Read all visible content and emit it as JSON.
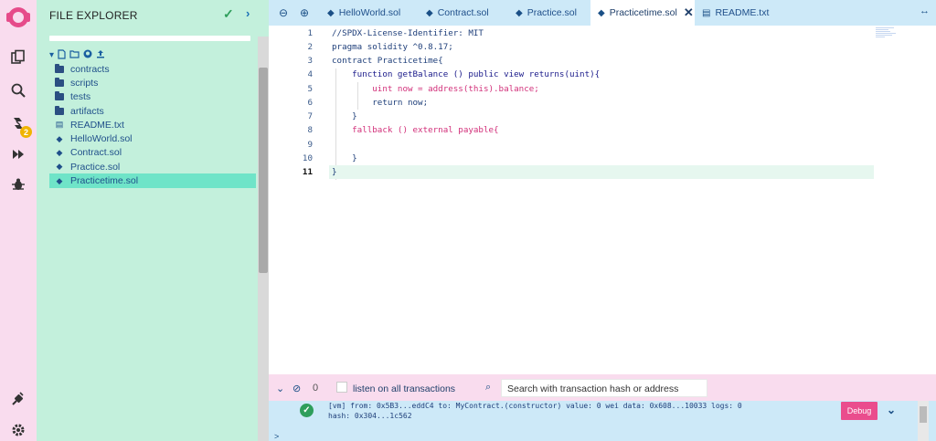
{
  "icon_panel": {
    "items": [
      {
        "name": "file-explorer-icon"
      },
      {
        "name": "search-icon"
      },
      {
        "name": "solidity-compiler-icon",
        "badge": "2"
      },
      {
        "name": "deploy-run-icon"
      },
      {
        "name": "debugger-icon"
      },
      {
        "name": "plugin-manager-icon"
      },
      {
        "name": "settings-icon"
      }
    ]
  },
  "file_explorer": {
    "title": "FILE EXPLORER",
    "items": [
      {
        "label": "contracts",
        "type": "folder"
      },
      {
        "label": "scripts",
        "type": "folder"
      },
      {
        "label": "tests",
        "type": "folder"
      },
      {
        "label": "artifacts",
        "type": "folder"
      },
      {
        "label": "README.txt",
        "type": "file"
      },
      {
        "label": "HelloWorld.sol",
        "type": "sol"
      },
      {
        "label": "Contract.sol",
        "type": "sol"
      },
      {
        "label": "Practice.sol",
        "type": "sol"
      },
      {
        "label": "Practicetime.sol",
        "type": "sol",
        "selected": true
      }
    ]
  },
  "tabs": [
    {
      "label": "HelloWorld.sol"
    },
    {
      "label": "Contract.sol"
    },
    {
      "label": "Practice.sol"
    },
    {
      "label": "Practicetime.sol",
      "active": true
    },
    {
      "label": "README.txt"
    }
  ],
  "editor": {
    "current_line": 11,
    "lines": [
      {
        "n": "1",
        "text": "//SPDX-License-Identifier: MIT"
      },
      {
        "n": "2",
        "text": "pragma solidity ^0.8.17;"
      },
      {
        "n": "3",
        "text": "contract Practicetime{"
      },
      {
        "n": "4",
        "text": "    function getBalance () public view returns(uint){"
      },
      {
        "n": "5",
        "text": "        uint now = address(this).balance;"
      },
      {
        "n": "6",
        "text": "        return now;"
      },
      {
        "n": "7",
        "text": "    }"
      },
      {
        "n": "8",
        "text": "    fallback () external payable{"
      },
      {
        "n": "9",
        "text": ""
      },
      {
        "n": "10",
        "text": "    }"
      },
      {
        "n": "11",
        "text": "}"
      }
    ]
  },
  "terminal": {
    "count": "0",
    "listen_label": "listen on all transactions",
    "search_placeholder": "Search with transaction hash or address",
    "log_line1": "[vm]  from: 0x5B3...eddC4 to: MyContract.(constructor) value: 0 wei data: 0x608...10033 logs: 0",
    "log_line2": "hash: 0x304...1c562",
    "debug_label": "Debug",
    "prompt": ">"
  },
  "colors": {
    "icon_panel_bg": "#f9dcee",
    "explorer_bg": "#c3f0dc",
    "selected_file_bg": "#6fe4c8",
    "tabbar_bg": "#cde9f8",
    "debug_button": "#ea4d8d",
    "success_green": "#2e9e5b"
  }
}
